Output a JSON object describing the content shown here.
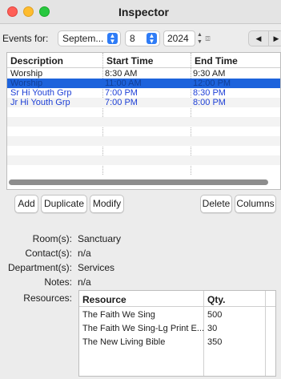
{
  "window": {
    "title": "Inspector"
  },
  "events_bar": {
    "label": "Events for:",
    "month": "Septem...",
    "day": "8",
    "year": "2024",
    "prev_icon": "triangle-left-icon",
    "next_icon": "triangle-right-icon"
  },
  "events_table": {
    "columns": [
      "Description",
      "Start Time",
      "End Time"
    ],
    "rows": [
      {
        "description": "Worship",
        "start": "8:30 AM",
        "end": "9:30 AM",
        "state": "normal"
      },
      {
        "description": "Worship",
        "start": "11:00 AM",
        "end": "12:00 PM",
        "state": "selected"
      },
      {
        "description": "Sr Hi Youth Grp",
        "start": "7:00 PM",
        "end": "8:30 PM",
        "state": "blue"
      },
      {
        "description": "Jr Hi Youth Grp",
        "start": "7:00 PM",
        "end": "8:00 PM",
        "state": "blue"
      }
    ]
  },
  "buttons": {
    "add": "Add",
    "duplicate": "Duplicate",
    "modify": "Modify",
    "delete": "Delete",
    "columns": "Columns"
  },
  "details": {
    "rooms_label": "Room(s):",
    "rooms_value": "Sanctuary",
    "contacts_label": "Contact(s):",
    "contacts_value": "n/a",
    "departments_label": "Department(s):",
    "departments_value": "Services",
    "notes_label": "Notes:",
    "notes_value": "n/a",
    "resources_label": "Resources:"
  },
  "resources_table": {
    "columns": [
      "Resource",
      "Qty."
    ],
    "rows": [
      {
        "resource": "The Faith We Sing",
        "qty": "500"
      },
      {
        "resource": "The Faith We Sing-Lg Print E...",
        "qty": "30"
      },
      {
        "resource": "The New Living Bible",
        "qty": "350"
      }
    ]
  },
  "colors": {
    "selection": "#1d63dc",
    "link_blue": "#1d3fd6",
    "close": "#ff5f57",
    "minimize": "#febc2e",
    "zoom": "#28c840"
  }
}
